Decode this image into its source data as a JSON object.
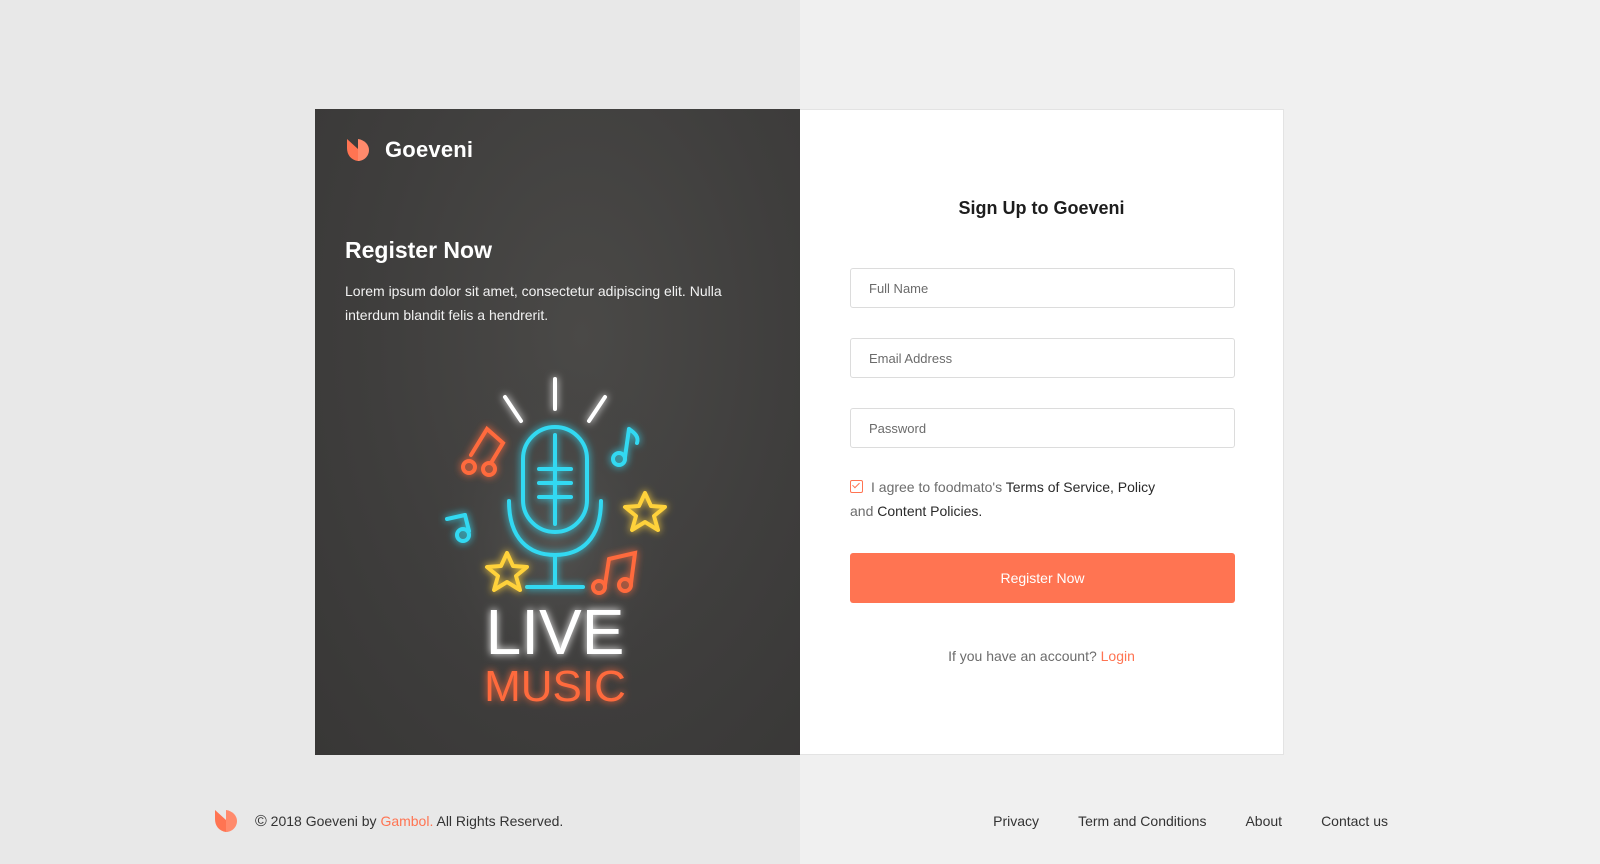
{
  "brand": {
    "name": "Goeveni",
    "accent_color": "#ff7452",
    "logo_icon": "goeveni-logo-icon"
  },
  "hero": {
    "title": "Register Now",
    "text": "Lorem ipsum dolor sit amet, consectetur adipiscing elit. Nulla interdum blandit felis a hendrerit.",
    "illustration_line1": "LIVE",
    "illustration_line2": "MUSIC"
  },
  "form": {
    "title": "Sign Up to Goeveni",
    "fields": {
      "full_name": {
        "placeholder": "Full Name",
        "value": ""
      },
      "email": {
        "placeholder": "Email Address",
        "value": ""
      },
      "password": {
        "placeholder": "Password",
        "value": ""
      }
    },
    "agree": {
      "checked": true,
      "prefix": "I agree to foodmato's ",
      "terms_link": "Terms of Service, Policy",
      "middle": "and ",
      "content_link": "Content Policies."
    },
    "submit_label": "Register Now",
    "login_prompt": "If you have an account? ",
    "login_link": "Login"
  },
  "footer": {
    "copyright_symbol": "©",
    "copyright_prefix": " 2018 Goeveni by ",
    "copyright_brand": "Gambol.",
    "copyright_suffix": " All Rights Reserved.",
    "nav": [
      "Privacy",
      "Term and Conditions",
      "About",
      "Contact us"
    ]
  }
}
